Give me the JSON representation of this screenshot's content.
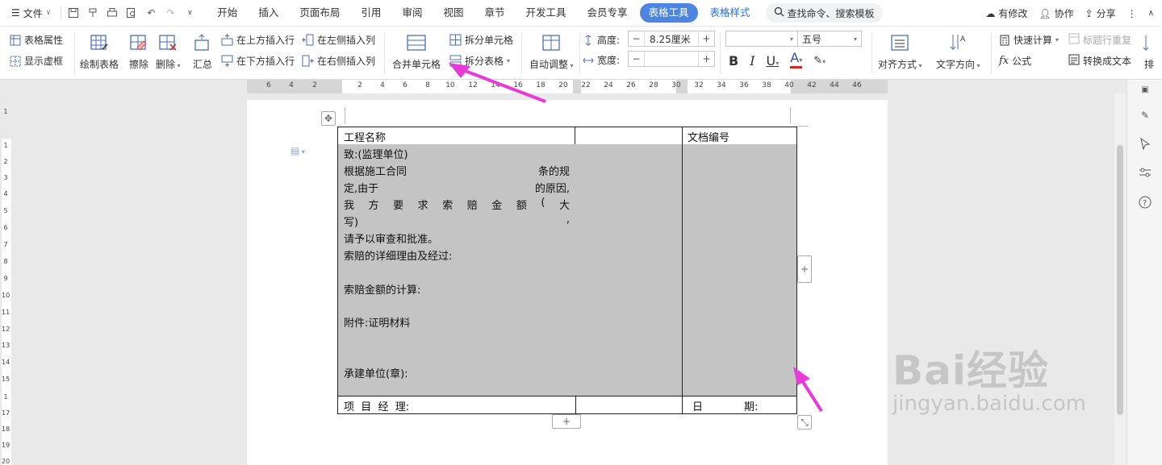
{
  "menu": {
    "file": "文件",
    "tabs": [
      "开始",
      "插入",
      "页面布局",
      "引用",
      "审阅",
      "视图",
      "章节",
      "开发工具",
      "会员专享",
      "表格工具",
      "表格样式"
    ],
    "search": "查找命令、搜索模板",
    "unsaved": "有修改",
    "collab": "协作",
    "share": "分享"
  },
  "ribbon": {
    "table_props": "表格属性",
    "show_grid": "显示虚框",
    "draw_table": "绘制表格",
    "erase": "擦除",
    "delete": "删除",
    "summary": "汇总",
    "insert_above": "在上方插入行",
    "insert_below": "在下方插入行",
    "insert_left": "在左侧插入列",
    "insert_right": "在右侧插入列",
    "merge_cells": "合并单元格",
    "split_cells": "拆分单元格",
    "split_table": "拆分表格",
    "auto_fit": "自动调整",
    "height_label": "高度:",
    "height_value": "8.25厘米",
    "width_label": "宽度:",
    "width_value": "",
    "font_name": "",
    "font_size": "五号",
    "align": "对齐方式",
    "text_dir": "文字方向",
    "quick_calc": "快速计算",
    "title_repeat": "标题行重复",
    "formula": "公式",
    "to_text": "转换成文本",
    "sort": "排"
  },
  "ruler": {
    "ticks": [
      "6",
      "4",
      "2",
      "2",
      "4",
      "6",
      "8",
      "10",
      "12",
      "14",
      "16",
      "18",
      "20",
      "22",
      "24",
      "26",
      "28",
      "30",
      "32",
      "34",
      "36",
      "38",
      "40",
      "42",
      "44",
      "46"
    ]
  },
  "vruler": {
    "ticks": [
      "1",
      "1",
      "2",
      "3",
      "4",
      "5",
      "6",
      "7",
      "8",
      "9",
      "10",
      "11",
      "12",
      "13",
      "14",
      "15",
      "1",
      "17",
      "18",
      "19",
      "20"
    ]
  },
  "table": {
    "project_name": "工程名称",
    "doc_no": "文档编号",
    "to": "致:(监理单位)",
    "l1a": "根据施工合同",
    "l1b": "条的规",
    "l2a": "定,由于",
    "l2b": "的原因,",
    "l3": [
      "我",
      "方",
      "要",
      "求",
      "索",
      "赔",
      "金",
      "额",
      "(",
      "大"
    ],
    "l4a": "写)",
    "l4b": ",",
    "l5": "请予以审查和批准。",
    "l6": "索赔的详细理由及经过:",
    "l7": "索赔金额的计算:",
    "l8": "附件:证明材料",
    "l9": "承建单位(章):",
    "pm": "项  目  经  理:",
    "date_a": "日",
    "date_b": "期:"
  },
  "watermark": {
    "brand": "Bai经验",
    "url": "jingyan.baidu.com"
  },
  "colors": {
    "accent": "#4c86e0",
    "cell_gray": "#c4c4c4",
    "arrow": "#e83ad8"
  }
}
